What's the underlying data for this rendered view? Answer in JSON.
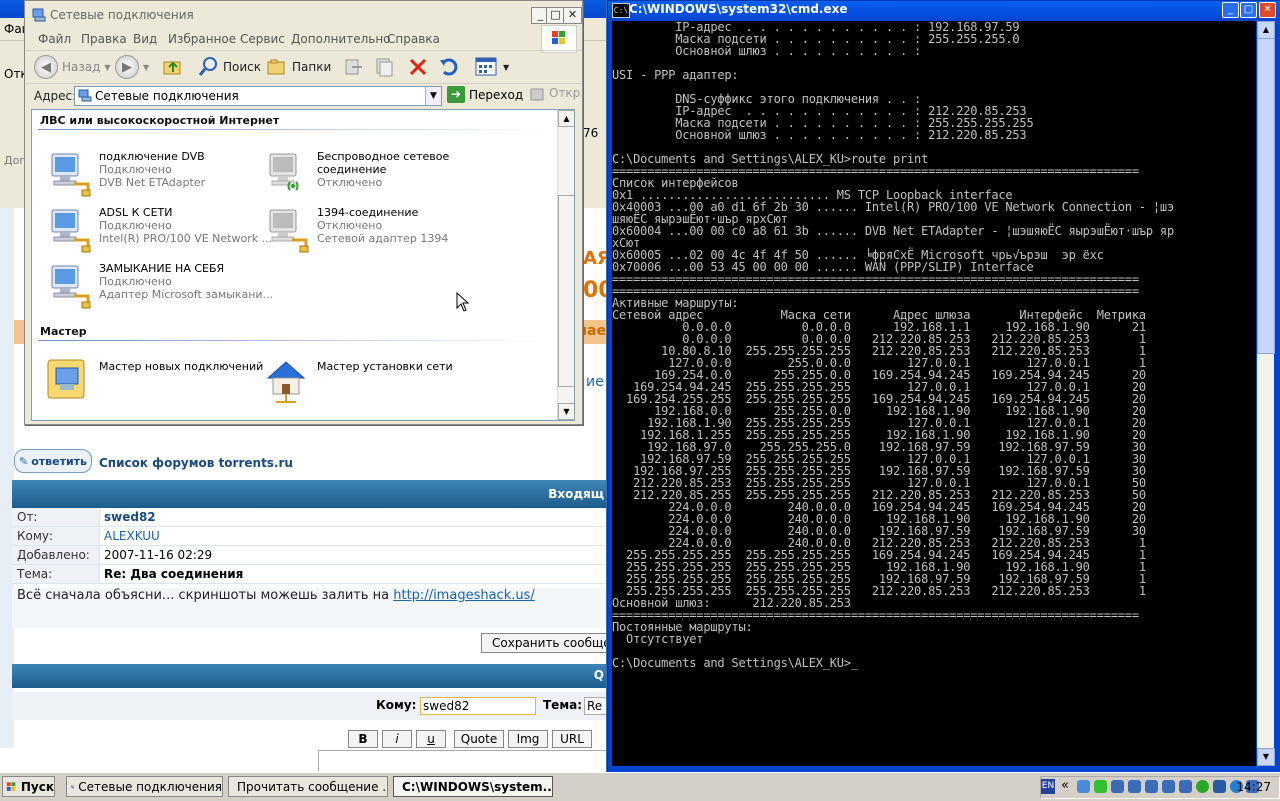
{
  "net_window": {
    "title": "Сетевые подключения",
    "menu": [
      "Файл",
      "Правка",
      "Вид",
      "Избранное",
      "Сервис",
      "Дополнительно",
      "Справка"
    ],
    "toolbar": {
      "back": "Назад",
      "search": "Поиск",
      "folders": "Папки"
    },
    "address_label": "Адрес:",
    "address_value": "Сетевые подключения",
    "go_label": "Переход",
    "open_label": "Откр",
    "section_lan": "ЛВС или высокоскоростной Интернет",
    "connections": [
      {
        "name": "подключение DVB",
        "status": "Подключено",
        "device": "DVB Net ETAdapter"
      },
      {
        "name": "Беспроводное сетевое",
        "name2": "соединение",
        "status": "Отключено"
      },
      {
        "name": "ADSL К СЕТИ",
        "status": "Подключено",
        "device": "Intel(R) PRO/100 VE Network ..."
      },
      {
        "name": "1394-соединение",
        "status": "Отключено",
        "device": "Сетевой адаптер 1394"
      },
      {
        "name": "ЗАМЫКАНИЕ НА СЕБЯ",
        "status": "Подключено",
        "device": "Адаптер Microsoft замыкани..."
      }
    ],
    "section_wizard": "Мастер",
    "wizards": [
      "Мастер новых подключений",
      "Мастер установки сети"
    ]
  },
  "browser": {
    "partial_menu": "Фай",
    "partial_left": [
      "Отк",
      "Дог"
    ],
    "address_fragment": "76",
    "link_fragment_1": "ие",
    "link_fragment_2": "",
    "ad_fragment": "ощиае",
    "reply_label": "ответить",
    "forum_link": "Список форумов torrents.ru",
    "inbox_label": "Входящ",
    "message": {
      "from_label": "От:",
      "from": "swed82",
      "to_label": "Кому:",
      "to": "ALEXKUU",
      "added_label": "Добавлено:",
      "added": "2007-11-16 02:29",
      "subject_label": "Тема:",
      "subject": "Re: Два соединения",
      "body": "Всё сначала объясни... скриншоты можешь залить на ",
      "body_link": "http://imageshack.us/"
    },
    "save_button": "Сохранить сообщен",
    "compose_bar": "Q",
    "compose_to_label": "Кому:",
    "compose_to_value": "swed82",
    "compose_subject_label": "Тема:",
    "compose_subject_value": "Re",
    "format_buttons": [
      "B",
      "i",
      "u",
      "Quote",
      "Img",
      "URL"
    ]
  },
  "cmd": {
    "title": "C:\\WINDOWS\\system32\\cmd.exe",
    "output": "         IP-адрес  . . . . . . . . . . . . : 192.168.97.59\n         Маска подсети . . . . . . . . . . : 255.255.255.0\n         Основной шлюз . . . . . . . . . . :\n\nUSI - PPP адаптер:\n\n         DNS-суффикс этого подключения . . :\n         IP-адрес  . . . . . . . . . . . . : 212.220.85.253\n         Маска подсети . . . . . . . . . . : 255.255.255.255\n         Основной шлюз . . . . . . . . . . : 212.220.85.253\n\nC:\\Documents and Settings\\ALEX_KU>route print\n===========================================================================\nСписок интерфейсов\n0x1 ........................... MS TCP Loopback interface\n0x40003 ...00 a0 d1 6f 2b 30 ...... Intel(R) PRO/100 VE Network Connection - ¦шэ\nшяюЁС яырэшЁют·шър ярхСют\n0x60004 ...00 00 c0 a8 61 3b ...... DVB Net ETAdapter - ¦шэшяюЁС яырэшЁют·шър яр\nхСют\n0x60005 ...02 00 4c 4f 4f 50 ...... ╘фряСхЁ Microsoft чрь√ърэш  эр ёхс\n0x70006 ...00 53 45 00 00 00 ...... WAN (PPP/SLIP) Interface\n===========================================================================\n===========================================================================\nАктивные маршруты:\nСетевой адрес           Маска сети      Адрес шлюза       Интерфейс  Метрика\n          0.0.0.0          0.0.0.0      192.168.1.1     192.168.1.90      21\n          0.0.0.0          0.0.0.0   212.220.85.253   212.220.85.253       1\n       10.80.8.10  255.255.255.255   212.220.85.253   212.220.85.253       1\n        127.0.0.0        255.0.0.0        127.0.0.1        127.0.0.1       1\n      169.254.0.0      255.255.0.0   169.254.94.245   169.254.94.245      20\n   169.254.94.245  255.255.255.255        127.0.0.1        127.0.0.1      20\n  169.254.255.255  255.255.255.255   169.254.94.245   169.254.94.245      20\n      192.168.0.0      255.255.0.0     192.168.1.90     192.168.1.90      20\n     192.168.1.90  255.255.255.255        127.0.0.1        127.0.0.1      20\n    192.168.1.255  255.255.255.255     192.168.1.90     192.168.1.90      20\n     192.168.97.0    255.255.255.0    192.168.97.59    192.168.97.59      30\n    192.168.97.59  255.255.255.255        127.0.0.1        127.0.0.1      30\n   192.168.97.255  255.255.255.255    192.168.97.59    192.168.97.59      30\n   212.220.85.253  255.255.255.255        127.0.0.1        127.0.0.1      50\n   212.220.85.255  255.255.255.255   212.220.85.253   212.220.85.253      50\n        224.0.0.0        240.0.0.0   169.254.94.245   169.254.94.245      20\n        224.0.0.0        240.0.0.0     192.168.1.90     192.168.1.90      20\n        224.0.0.0        240.0.0.0    192.168.97.59    192.168.97.59      30\n        224.0.0.0        240.0.0.0   212.220.85.253   212.220.85.253       1\n  255.255.255.255  255.255.255.255   169.254.94.245   169.254.94.245       1\n  255.255.255.255  255.255.255.255     192.168.1.90     192.168.1.90       1\n  255.255.255.255  255.255.255.255    192.168.97.59    192.168.97.59       1\n  255.255.255.255  255.255.255.255   212.220.85.253   212.220.85.253       1\nОсновной шлюз:      212.220.85.253\n===========================================================================\nПостоянные маршруты:\n  Отсутствует\n\nC:\\Documents and Settings\\ALEX_KU>_"
  },
  "taskbar": {
    "start": "Пуск",
    "tasks": [
      "Сетевые подключения",
      "Прочитать сообщение ...",
      "C:\\WINDOWS\\system..."
    ],
    "lang": "EN",
    "clock": "14:27"
  },
  "colors": {
    "xp_blue": "#0a5ae0",
    "cmd_bg": "#000000",
    "cmd_fg": "#c0c0c0",
    "forum_bar": "#1c5d8c"
  }
}
